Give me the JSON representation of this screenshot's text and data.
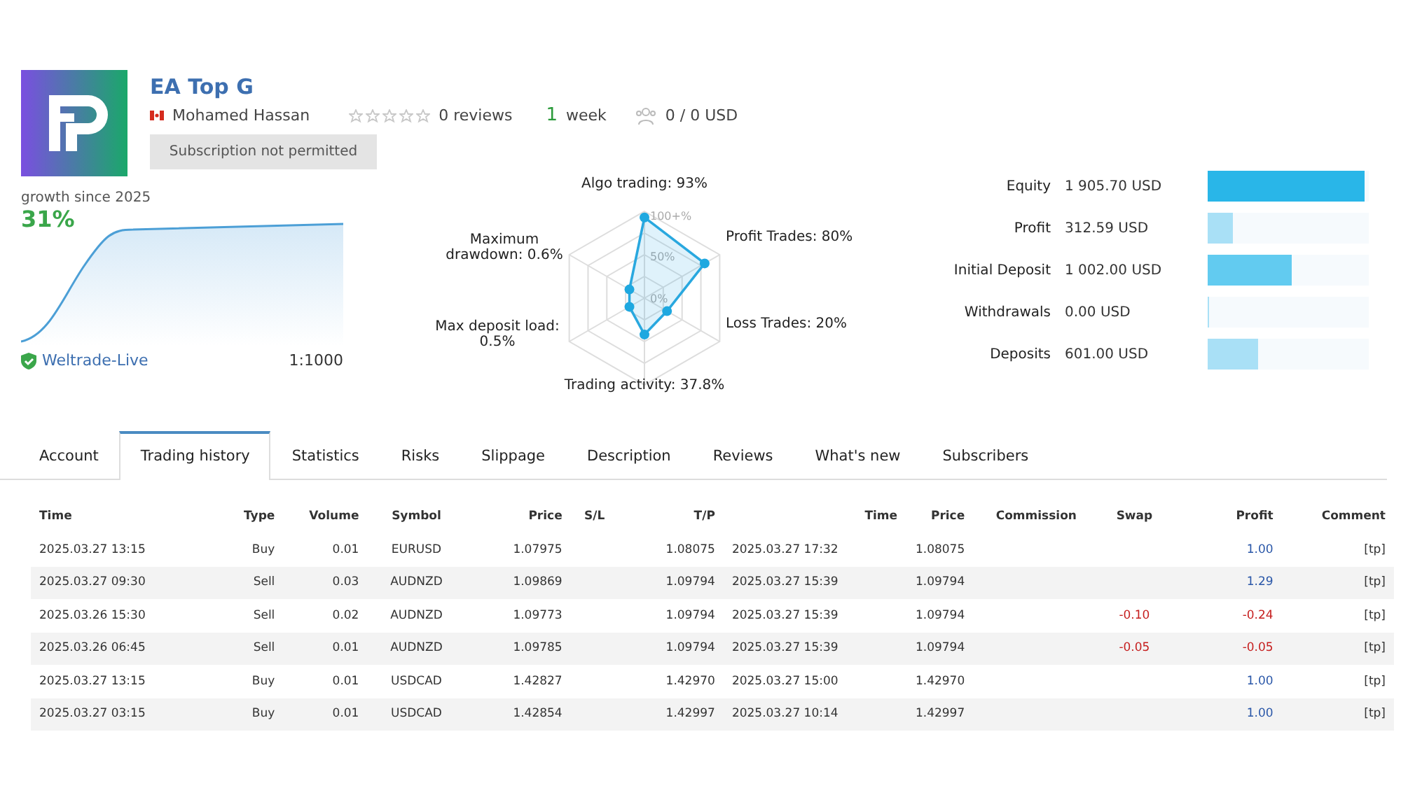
{
  "header": {
    "title": "EA Top G",
    "author": "Mohamed Hassan",
    "stars": 0,
    "reviews": "0 reviews",
    "age_number": "1",
    "age_unit": "week",
    "subscribers": "0 / 0 USD",
    "subscribe_button": {
      "label": "Subscription not permitted",
      "disabled": true
    }
  },
  "growth": {
    "caption": "growth since 2025",
    "value": "31%",
    "broker": "Weltrade-Live",
    "leverage": "1:1000"
  },
  "radar": {
    "ring_labels": [
      "100+%",
      "50%",
      "0%"
    ],
    "axes": [
      {
        "label": "Algo trading: 93%"
      },
      {
        "label": "Maximum drawdown: 0.6%"
      },
      {
        "label": "Profit Trades: 80%"
      },
      {
        "label": "Max deposit load: 0.5%"
      },
      {
        "label": "Loss Trades: 20%"
      },
      {
        "label": "Trading activity: 37.8%"
      }
    ]
  },
  "balance": [
    {
      "label": "Equity",
      "value": "1 905.70 USD",
      "level": 0.97,
      "color": "#29b6e8"
    },
    {
      "label": "Profit",
      "value": "312.59 USD",
      "level": 0.16,
      "color": "#a9e0f6"
    },
    {
      "label": "Initial Deposit",
      "value": "1 002.00 USD",
      "level": 0.52,
      "color": "#62cbf0"
    },
    {
      "label": "Withdrawals",
      "value": "0.00 USD",
      "level": 0.005,
      "color": "#a9e0f6"
    },
    {
      "label": "Deposits",
      "value": "601.00 USD",
      "level": 0.31,
      "color": "#a9e0f6"
    }
  ],
  "tabs": [
    {
      "label": "Account",
      "selected": false
    },
    {
      "label": "Trading history",
      "selected": true
    },
    {
      "label": "Statistics",
      "selected": false
    },
    {
      "label": "Risks",
      "selected": false
    },
    {
      "label": "Slippage",
      "selected": false
    },
    {
      "label": "Description",
      "selected": false
    },
    {
      "label": "Reviews",
      "selected": false
    },
    {
      "label": "What's new",
      "selected": false
    },
    {
      "label": "Subscribers",
      "selected": false
    }
  ],
  "table": {
    "columns": [
      "Time",
      "Type",
      "Volume",
      "Symbol",
      "Price",
      "S/L",
      "T/P",
      "Time",
      "Price",
      "Commission",
      "Swap",
      "Profit",
      "Comment"
    ],
    "rows": [
      {
        "loss": false,
        "cells": [
          "2025.03.27 13:15",
          "Buy",
          "0.01",
          "EURUSD",
          "1.07975",
          "",
          "1.08075",
          "2025.03.27 17:32",
          "1.08075",
          "",
          "",
          "1.00",
          "[tp]"
        ]
      },
      {
        "loss": false,
        "cells": [
          "2025.03.27 09:30",
          "Sell",
          "0.03",
          "AUDNZD",
          "1.09869",
          "",
          "1.09794",
          "2025.03.27 15:39",
          "1.09794",
          "",
          "",
          "1.29",
          "[tp]"
        ]
      },
      {
        "loss": true,
        "cells": [
          "2025.03.26 15:30",
          "Sell",
          "0.02",
          "AUDNZD",
          "1.09773",
          "",
          "1.09794",
          "2025.03.27 15:39",
          "1.09794",
          "",
          "-0.10",
          "-0.24",
          "[tp]"
        ]
      },
      {
        "loss": true,
        "cells": [
          "2025.03.26 06:45",
          "Sell",
          "0.01",
          "AUDNZD",
          "1.09785",
          "",
          "1.09794",
          "2025.03.27 15:39",
          "1.09794",
          "",
          "-0.05",
          "-0.05",
          "[tp]"
        ]
      },
      {
        "loss": false,
        "cells": [
          "2025.03.27 13:15",
          "Buy",
          "0.01",
          "USDCAD",
          "1.42827",
          "",
          "1.42970",
          "2025.03.27 15:00",
          "1.42970",
          "",
          "",
          "1.00",
          "[tp]"
        ]
      },
      {
        "loss": false,
        "cells": [
          "2025.03.27 03:15",
          "Buy",
          "0.01",
          "USDCAD",
          "1.42854",
          "",
          "1.42997",
          "2025.03.27 10:14",
          "1.42997",
          "",
          "",
          "1.00",
          "[tp]"
        ]
      }
    ]
  }
}
